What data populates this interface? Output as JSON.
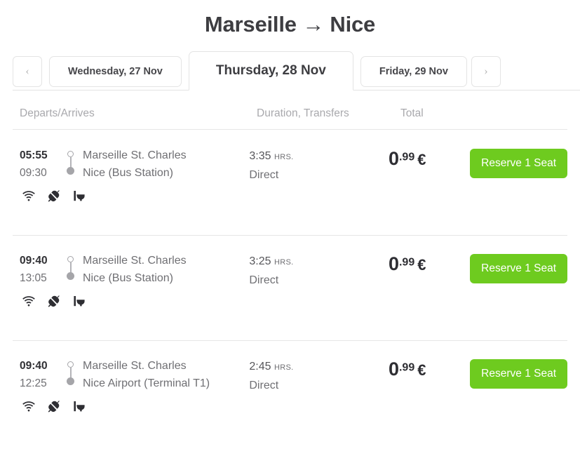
{
  "header": {
    "origin": "Marseille",
    "arrow": "→",
    "destination": "Nice",
    "title": "Marseille → Nice"
  },
  "date_tabs": {
    "prev_label": "‹",
    "next_label": "›",
    "tabs": [
      {
        "label": "Wednesday, 27 Nov",
        "active": false
      },
      {
        "label": "Thursday, 28 Nov",
        "active": true
      },
      {
        "label": "Friday, 29 Nov",
        "active": false
      }
    ]
  },
  "columns": {
    "departs_arrives": "Departs/Arrives",
    "duration_transfers": "Duration, Transfers",
    "total": "Total"
  },
  "trips": [
    {
      "depart_time": "05:55",
      "arrive_time": "09:30",
      "origin_station": "Marseille St. Charles",
      "destination_station": "Nice (Bus Station)",
      "amenities": [
        "wifi-icon",
        "power-plug-icon",
        "toilet-icon"
      ],
      "duration": "3:35",
      "duration_unit": "HRS.",
      "transfers": "Direct",
      "price_int": "0",
      "price_frac": ".99",
      "currency": "€",
      "action_label": "Reserve 1 Seat"
    },
    {
      "depart_time": "09:40",
      "arrive_time": "13:05",
      "origin_station": "Marseille St. Charles",
      "destination_station": "Nice (Bus Station)",
      "amenities": [
        "wifi-icon",
        "power-plug-icon",
        "toilet-icon"
      ],
      "duration": "3:25",
      "duration_unit": "HRS.",
      "transfers": "Direct",
      "price_int": "0",
      "price_frac": ".99",
      "currency": "€",
      "action_label": "Reserve 1 Seat"
    },
    {
      "depart_time": "09:40",
      "arrive_time": "12:25",
      "origin_station": "Marseille St. Charles",
      "destination_station": "Nice Airport (Terminal T1)",
      "amenities": [
        "wifi-icon",
        "power-plug-icon",
        "toilet-icon"
      ],
      "duration": "2:45",
      "duration_unit": "HRS.",
      "transfers": "Direct",
      "price_int": "0",
      "price_frac": ".99",
      "currency": "€",
      "action_label": "Reserve 1 Seat"
    }
  ],
  "colors": {
    "accent_green": "#6ecb1f",
    "title_dark": "#3d3d41",
    "muted_gray": "#a9a9ad",
    "text_gray": "#6f6f73"
  }
}
